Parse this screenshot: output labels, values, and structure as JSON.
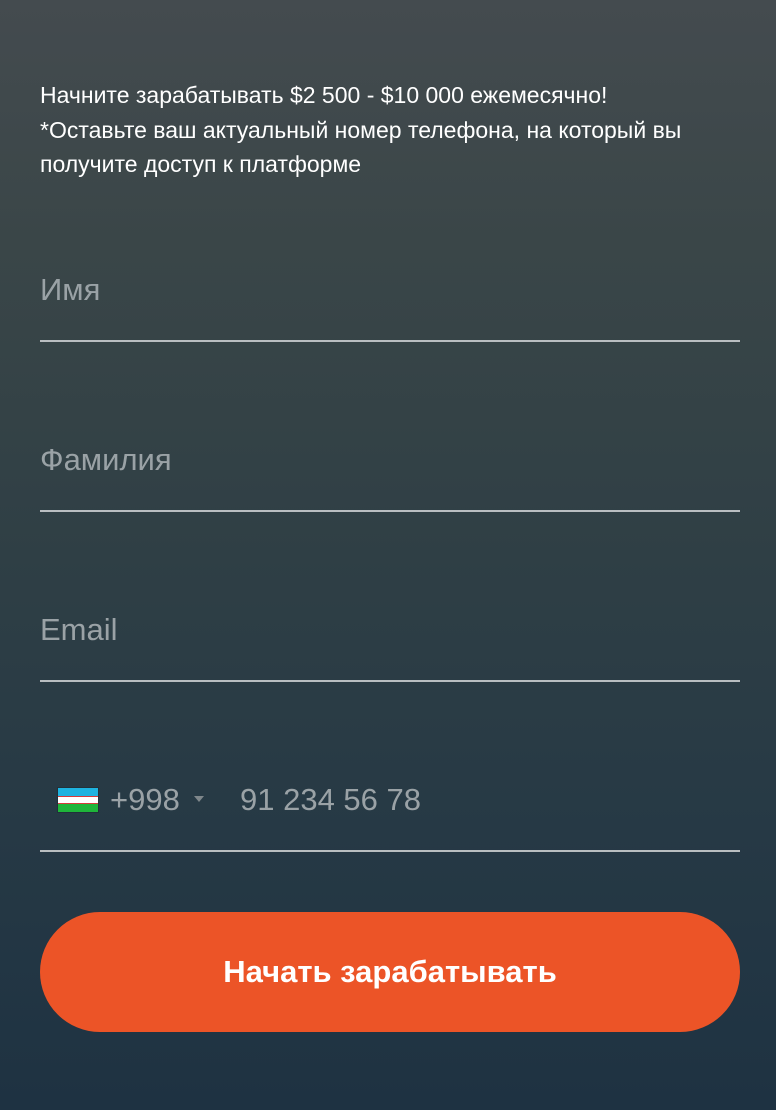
{
  "intro": {
    "line1": "Начните зарабатывать $2 500 - $10 000 ежемесячно!",
    "line2": "*Оставьте ваш актуальный номер телефона, на который вы",
    "line3": "получите доступ к платформе"
  },
  "form": {
    "first_name_placeholder": "Имя",
    "last_name_placeholder": "Фамилия",
    "email_placeholder": "Email",
    "phone": {
      "country_flag": "uzbekistan-flag",
      "dial_code": "+998",
      "placeholder": "91 234 56 78"
    },
    "submit_label": "Начать зарабатывать"
  },
  "colors": {
    "accent": "#ec5427",
    "background_top": "#444b4f",
    "background_bottom": "#1e3242",
    "placeholder": "#9aa2a6",
    "underline": "#b9bec1"
  }
}
